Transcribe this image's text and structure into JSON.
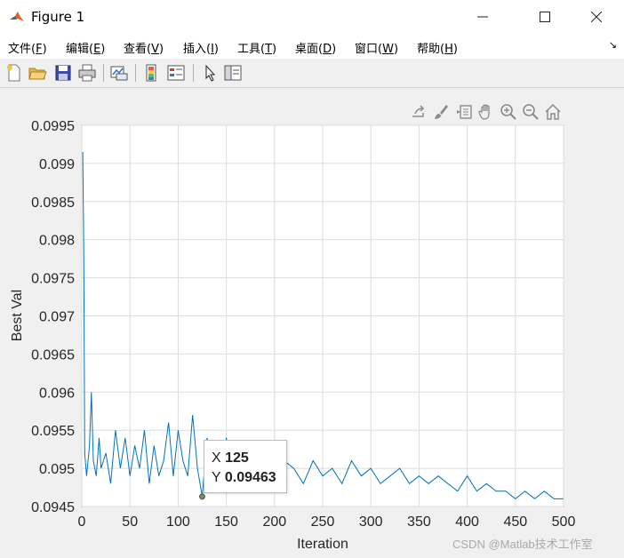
{
  "window": {
    "title": "Figure 1",
    "minimize_label": "—",
    "maximize_label": "☐",
    "close_label": "✕"
  },
  "menubar": {
    "items": [
      {
        "label": "文件(",
        "key": "F",
        "suffix": ")"
      },
      {
        "label": "编辑(",
        "key": "E",
        "suffix": ")"
      },
      {
        "label": "查看(",
        "key": "V",
        "suffix": ")"
      },
      {
        "label": "插入(",
        "key": "I",
        "suffix": ")"
      },
      {
        "label": "工具(",
        "key": "T",
        "suffix": ")"
      },
      {
        "label": "桌面(",
        "key": "D",
        "suffix": ")"
      },
      {
        "label": "窗口(",
        "key": "W",
        "suffix": ")"
      },
      {
        "label": "帮助(",
        "key": "H",
        "suffix": ")"
      }
    ]
  },
  "toolbar": {
    "icons": [
      "new-figure-icon",
      "open-file-icon",
      "save-icon",
      "print-icon",
      "link-plot-icon",
      "colorbar-icon",
      "legend-icon",
      "edit-plot-icon",
      "property-inspector-icon"
    ]
  },
  "axes_toolbar": {
    "icons": [
      "export-icon",
      "brush-icon",
      "data-tips-icon",
      "pan-icon",
      "zoom-in-icon",
      "zoom-out-icon",
      "home-icon"
    ]
  },
  "colors": {
    "line": "#0072bd",
    "grid": "#dcdcdc"
  },
  "chart_data": {
    "type": "line",
    "xlabel": "Iteration",
    "ylabel": "Best Val",
    "xlim": [
      0,
      500
    ],
    "ylim": [
      0.0945,
      0.0995
    ],
    "xticks": [
      0,
      50,
      100,
      150,
      200,
      250,
      300,
      350,
      400,
      450,
      500
    ],
    "yticks": [
      "0.0945",
      "0.095",
      "0.0955",
      "0.096",
      "0.0965",
      "0.097",
      "0.0975",
      "0.098",
      "0.0985",
      "0.099",
      "0.0995"
    ],
    "grid": true,
    "series": [
      {
        "x": [
          1,
          2,
          3,
          5,
          8,
          10,
          12,
          15,
          18,
          20,
          25,
          30,
          35,
          40,
          45,
          50,
          55,
          60,
          65,
          70,
          75,
          80,
          85,
          90,
          95,
          100,
          105,
          110,
          115,
          120,
          125,
          130,
          135,
          140,
          145,
          150,
          155,
          160,
          165,
          170,
          175,
          180,
          190,
          200,
          210,
          220,
          230,
          240,
          250,
          260,
          270,
          280,
          290,
          300,
          310,
          320,
          330,
          340,
          350,
          360,
          370,
          380,
          390,
          400,
          410,
          420,
          430,
          440,
          450,
          460,
          470,
          480,
          490,
          500
        ],
        "y": [
          0.09915,
          0.0979,
          0.0952,
          0.0949,
          0.0953,
          0.096,
          0.0951,
          0.0949,
          0.0954,
          0.095,
          0.0952,
          0.0948,
          0.0955,
          0.095,
          0.0954,
          0.0949,
          0.0953,
          0.095,
          0.0955,
          0.0948,
          0.0953,
          0.0949,
          0.0951,
          0.0956,
          0.0949,
          0.0955,
          0.0951,
          0.0949,
          0.0957,
          0.095,
          0.09463,
          0.0954,
          0.0951,
          0.0953,
          0.0949,
          0.0954,
          0.095,
          0.0953,
          0.0951,
          0.095,
          0.0951,
          0.095,
          0.0952,
          0.0949,
          0.0951,
          0.095,
          0.0948,
          0.0951,
          0.0949,
          0.095,
          0.0948,
          0.0951,
          0.0949,
          0.095,
          0.0948,
          0.0949,
          0.095,
          0.0948,
          0.0949,
          0.0948,
          0.0949,
          0.0948,
          0.0947,
          0.0949,
          0.0947,
          0.0948,
          0.0947,
          0.0947,
          0.0946,
          0.0947,
          0.0946,
          0.0947,
          0.0946,
          0.0946
        ]
      }
    ]
  },
  "datatip": {
    "x_label": "X",
    "x_value": "125",
    "y_label": "Y",
    "y_value": "0.09463",
    "x": 125,
    "y": 0.09463
  },
  "watermark": "CSDN @Matlab技术工作室"
}
